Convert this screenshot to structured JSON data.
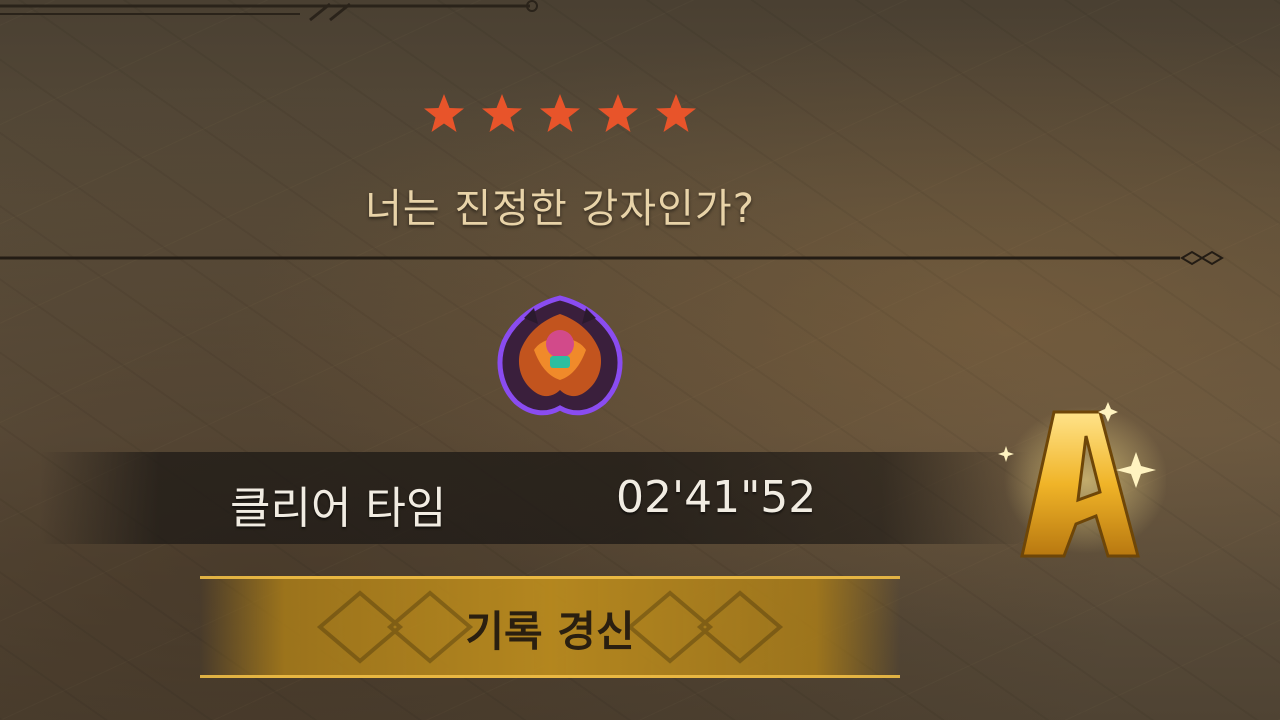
{
  "stage": {
    "star_count": 5,
    "star_color": "#e8542a",
    "title": "너는 진정한 강자인가?"
  },
  "result": {
    "clear_time_label": "클리어 타임",
    "clear_time_value": "02'41\"52",
    "rank": "A",
    "rank_color": "#f0b428"
  },
  "banner": {
    "label": "기록 경신",
    "color": "#b98a1e"
  }
}
